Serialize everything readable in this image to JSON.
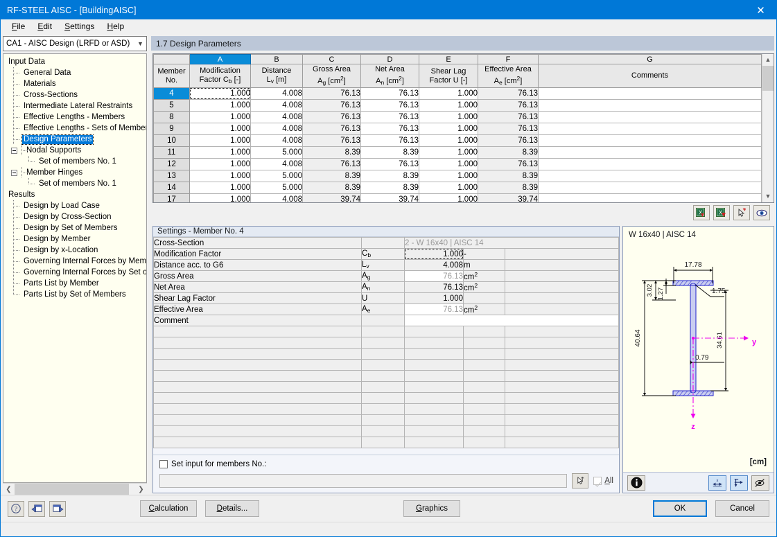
{
  "window": {
    "title": "RF-STEEL AISC - [BuildingAISC]",
    "close_label": "✕"
  },
  "menu": [
    {
      "label": "File",
      "accel": "F"
    },
    {
      "label": "Edit",
      "accel": "E"
    },
    {
      "label": "Settings",
      "accel": "S"
    },
    {
      "label": "Help",
      "accel": "H"
    }
  ],
  "sidebar": {
    "combo_value": "CA1 - AISC Design (LRFD or ASD)",
    "groups": [
      {
        "label": "Input Data",
        "items": [
          {
            "label": "General Data",
            "selected": false,
            "level": 1
          },
          {
            "label": "Materials",
            "selected": false,
            "level": 1
          },
          {
            "label": "Cross-Sections",
            "selected": false,
            "level": 1
          },
          {
            "label": "Intermediate Lateral Restraints",
            "selected": false,
            "level": 1
          },
          {
            "label": "Effective Lengths - Members",
            "selected": false,
            "level": 1
          },
          {
            "label": "Effective Lengths - Sets of Members",
            "selected": false,
            "level": 1
          },
          {
            "label": "Design Parameters",
            "selected": true,
            "level": 1
          },
          {
            "label": "Nodal Supports",
            "selected": false,
            "level": 1,
            "expandable": true
          },
          {
            "label": "Set of members No. 1",
            "selected": false,
            "level": 2
          },
          {
            "label": "Member Hinges",
            "selected": false,
            "level": 1,
            "expandable": true
          },
          {
            "label": "Set of members No. 1",
            "selected": false,
            "level": 2
          }
        ]
      },
      {
        "label": "Results",
        "items": [
          {
            "label": "Design by Load Case",
            "selected": false,
            "level": 1
          },
          {
            "label": "Design by Cross-Section",
            "selected": false,
            "level": 1
          },
          {
            "label": "Design by Set of Members",
            "selected": false,
            "level": 1
          },
          {
            "label": "Design by Member",
            "selected": false,
            "level": 1
          },
          {
            "label": "Design by x-Location",
            "selected": false,
            "level": 1
          },
          {
            "label": "Governing Internal Forces by Member",
            "selected": false,
            "level": 1
          },
          {
            "label": "Governing Internal Forces by Set of M",
            "selected": false,
            "level": 1
          },
          {
            "label": "Parts List by Member",
            "selected": false,
            "level": 1
          },
          {
            "label": "Parts List by Set of Members",
            "selected": false,
            "level": 1
          }
        ]
      }
    ]
  },
  "panel": {
    "title": "1.7 Design Parameters"
  },
  "grid": {
    "column_letters": [
      "",
      "A",
      "B",
      "C",
      "D",
      "E",
      "F",
      "G"
    ],
    "active_column": "A",
    "headers": [
      {
        "line1": "Member",
        "line2": "No."
      },
      {
        "line1": "Modification",
        "line2": "Factor C",
        "sub2": "b",
        "tail2": " [-]"
      },
      {
        "line1": "Distance",
        "line2": "L",
        "sub2": "v",
        "tail2": " [m]"
      },
      {
        "line1": "Gross Area",
        "line2": "A",
        "sub2": "g",
        "tail2": " [cm",
        "sup2": "2",
        "tail3": "]"
      },
      {
        "line1": "Net Area",
        "line2": "A",
        "sub2": "n",
        "tail2": " [cm",
        "sup2": "2",
        "tail3": "]"
      },
      {
        "line1": "Shear Lag",
        "line2": "Factor U [-]"
      },
      {
        "line1": "Effective Area",
        "line2": "A",
        "sub2": "e",
        "tail2": " [cm",
        "sup2": "2",
        "tail3": "]"
      },
      {
        "line1": "",
        "line2": "Comments"
      }
    ],
    "rows": [
      {
        "member": "4",
        "cb": "1.000",
        "lv": "4.008",
        "ag": "76.13",
        "an": "76.13",
        "u": "1.000",
        "ae": "76.13",
        "comment": "",
        "selected": true
      },
      {
        "member": "5",
        "cb": "1.000",
        "lv": "4.008",
        "ag": "76.13",
        "an": "76.13",
        "u": "1.000",
        "ae": "76.13",
        "comment": ""
      },
      {
        "member": "8",
        "cb": "1.000",
        "lv": "4.008",
        "ag": "76.13",
        "an": "76.13",
        "u": "1.000",
        "ae": "76.13",
        "comment": ""
      },
      {
        "member": "9",
        "cb": "1.000",
        "lv": "4.008",
        "ag": "76.13",
        "an": "76.13",
        "u": "1.000",
        "ae": "76.13",
        "comment": ""
      },
      {
        "member": "10",
        "cb": "1.000",
        "lv": "4.008",
        "ag": "76.13",
        "an": "76.13",
        "u": "1.000",
        "ae": "76.13",
        "comment": ""
      },
      {
        "member": "11",
        "cb": "1.000",
        "lv": "5.000",
        "ag": "8.39",
        "an": "8.39",
        "u": "1.000",
        "ae": "8.39",
        "comment": ""
      },
      {
        "member": "12",
        "cb": "1.000",
        "lv": "4.008",
        "ag": "76.13",
        "an": "76.13",
        "u": "1.000",
        "ae": "76.13",
        "comment": ""
      },
      {
        "member": "13",
        "cb": "1.000",
        "lv": "5.000",
        "ag": "8.39",
        "an": "8.39",
        "u": "1.000",
        "ae": "8.39",
        "comment": ""
      },
      {
        "member": "14",
        "cb": "1.000",
        "lv": "5.000",
        "ag": "8.39",
        "an": "8.39",
        "u": "1.000",
        "ae": "8.39",
        "comment": ""
      },
      {
        "member": "17",
        "cb": "1.000",
        "lv": "4.008",
        "ag": "39.74",
        "an": "39.74",
        "u": "1.000",
        "ae": "39.74",
        "comment": ""
      }
    ],
    "tools": [
      {
        "name": "excel-import-icon"
      },
      {
        "name": "excel-export-icon"
      },
      {
        "name": "pick-from-model-icon"
      },
      {
        "name": "view-mode-icon"
      }
    ]
  },
  "settings": {
    "title": "Settings - Member No. 4",
    "rows": [
      {
        "label": "Cross-Section",
        "symbol": "",
        "sub": "",
        "value": "2 - W 16x40 | AISC 14",
        "unit": "",
        "readonly": true,
        "is_xsection": true
      },
      {
        "label": "Modification Factor",
        "symbol": "C",
        "sub": "b",
        "value": "1.000",
        "unit": "-",
        "focused": true
      },
      {
        "label": "Distance acc. to G6",
        "symbol": "L",
        "sub": "v",
        "value": "4.008",
        "unit": "m"
      },
      {
        "label": "Gross Area",
        "symbol": "A",
        "sub": "g",
        "value": "76.13",
        "unit": "cm",
        "unit_sup": "2",
        "readonly": true
      },
      {
        "label": "Net Area",
        "symbol": "A",
        "sub": "n",
        "value": "76.13",
        "unit": "cm",
        "unit_sup": "2"
      },
      {
        "label": "Shear Lag Factor",
        "symbol": "U",
        "sub": "",
        "value": "1.000",
        "unit": ""
      },
      {
        "label": "Effective Area",
        "symbol": "A",
        "sub": "e",
        "value": "76.13",
        "unit": "cm",
        "unit_sup": "2",
        "readonly": true
      },
      {
        "label": "Comment",
        "symbol": "",
        "sub": "",
        "value": "",
        "unit": "",
        "is_comment": true
      }
    ],
    "empty_row_count": 11,
    "set_input_label": "Set input for members No.:",
    "set_input_checked": false,
    "members_field_value": "",
    "all_label": "All",
    "all_checked": true,
    "pick_icon": "pick-members-icon"
  },
  "graphic": {
    "title": "W 16x40 | AISC 14",
    "unit_label": "[cm]",
    "dimensions": {
      "width": "17.78",
      "height": "40.64",
      "flange_group": "3.02",
      "flange_thickness": "1.27",
      "fillet": "1.75",
      "web_thickness": "0.79",
      "inner_depth": "34.61"
    },
    "axes": {
      "y": "y",
      "z": "z"
    },
    "buttons": [
      {
        "name": "info-icon",
        "active": false
      },
      {
        "name": "dimensions-x-icon",
        "active": true
      },
      {
        "name": "dimensions-axes-icon",
        "active": true
      },
      {
        "name": "hide-dimensions-icon",
        "active": false
      }
    ]
  },
  "footer": {
    "help_icon": "help-icon",
    "prev_icon": "previous-table-icon",
    "next_icon": "next-table-icon",
    "calculation_label": "Calculation",
    "calculation_accel": "C",
    "details_label": "Details...",
    "details_accel": "D",
    "graphics_label": "Graphics",
    "graphics_accel": "G",
    "ok_label": "OK",
    "cancel_label": "Cancel"
  }
}
